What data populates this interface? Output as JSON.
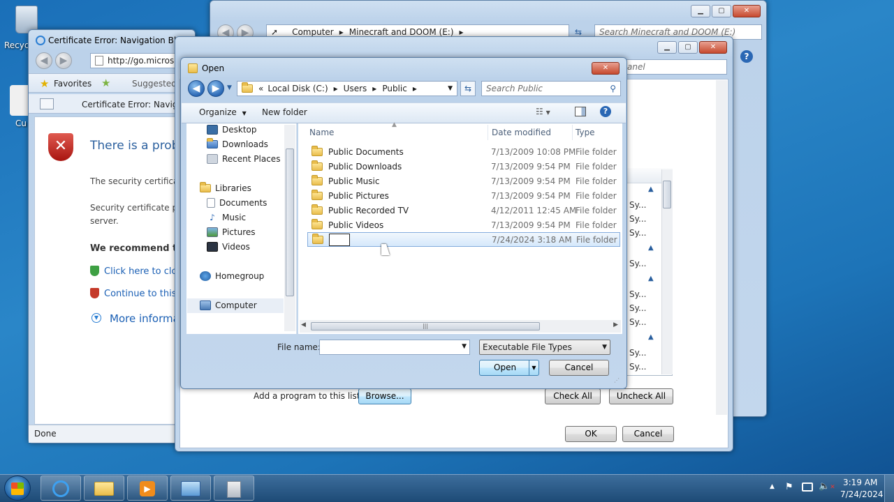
{
  "desktop": {
    "recycle_label": "Recyc",
    "cu_label": "Cu"
  },
  "ie_window": {
    "title": "Certificate Error: Navigation Blocke",
    "address": "http://go.microsof",
    "favorites": "Favorites",
    "suggested": "Suggested S",
    "tab": "Certificate Error: Navigati",
    "heading": "There is a probl",
    "para1": "The security certifica",
    "para2a": "Security certificate p",
    "para2b": "server.",
    "recommend": "We recommend th",
    "link_close": "Click here to clos",
    "link_continue": "Continue to this",
    "more_info": "More informa",
    "status": "Done"
  },
  "explorer_window": {
    "breadcrumb": [
      "Computer",
      "Minecraft and DOOM (E:)"
    ],
    "search_placeholder": "Search Minecraft and DOOM (E:)"
  },
  "control_window": {
    "search_fragment": "anel",
    "sy_items": [
      "Sy...",
      "Sy...",
      "Sy...",
      "Sy...",
      "Sy...",
      "Sy...",
      "Sy...",
      "Sy...",
      "Sy..."
    ],
    "add_program_label": "Add a program to this list:",
    "browse": "Browse...",
    "check_all": "Check All",
    "uncheck_all": "Uncheck All",
    "ok": "OK",
    "cancel": "Cancel"
  },
  "open_dialog": {
    "title": "Open",
    "breadcrumb": [
      "Local Disk (C:)",
      "Users",
      "Public"
    ],
    "breadcrumb_prefix": "«",
    "search_placeholder": "Search Public",
    "organize": "Organize",
    "new_folder": "New folder",
    "tree": [
      {
        "label": "Desktop",
        "icon": "desktop-icon"
      },
      {
        "label": "Downloads",
        "icon": "downloads-icon"
      },
      {
        "label": "Recent Places",
        "icon": "recent-places-icon"
      },
      {
        "label": "Libraries",
        "icon": "libraries-icon"
      },
      {
        "label": "Documents",
        "icon": "documents-icon"
      },
      {
        "label": "Music",
        "icon": "music-icon"
      },
      {
        "label": "Pictures",
        "icon": "pictures-icon"
      },
      {
        "label": "Videos",
        "icon": "videos-icon"
      },
      {
        "label": "Homegroup",
        "icon": "homegroup-icon"
      },
      {
        "label": "Computer",
        "icon": "computer-icon"
      }
    ],
    "columns": {
      "name": "Name",
      "date": "Date modified",
      "type": "Type"
    },
    "files": [
      {
        "name": "Public Documents",
        "date": "7/13/2009 10:08 PM",
        "type": "File folder"
      },
      {
        "name": "Public Downloads",
        "date": "7/13/2009 9:54 PM",
        "type": "File folder"
      },
      {
        "name": "Public Music",
        "date": "7/13/2009 9:54 PM",
        "type": "File folder"
      },
      {
        "name": "Public Pictures",
        "date": "7/13/2009 9:54 PM",
        "type": "File folder"
      },
      {
        "name": "Public Recorded TV",
        "date": "4/12/2011 12:45 AM",
        "type": "File folder"
      },
      {
        "name": "Public Videos",
        "date": "7/13/2009 9:54 PM",
        "type": "File folder"
      },
      {
        "name": "",
        "date": "7/24/2024 3:18 AM",
        "type": "File folder"
      }
    ],
    "file_name_label": "File name:",
    "file_name_value": "",
    "file_type": "Executable File Types",
    "open": "Open",
    "cancel": "Cancel"
  },
  "taskbar": {
    "time": "3:19 AM",
    "date": "7/24/2024"
  }
}
